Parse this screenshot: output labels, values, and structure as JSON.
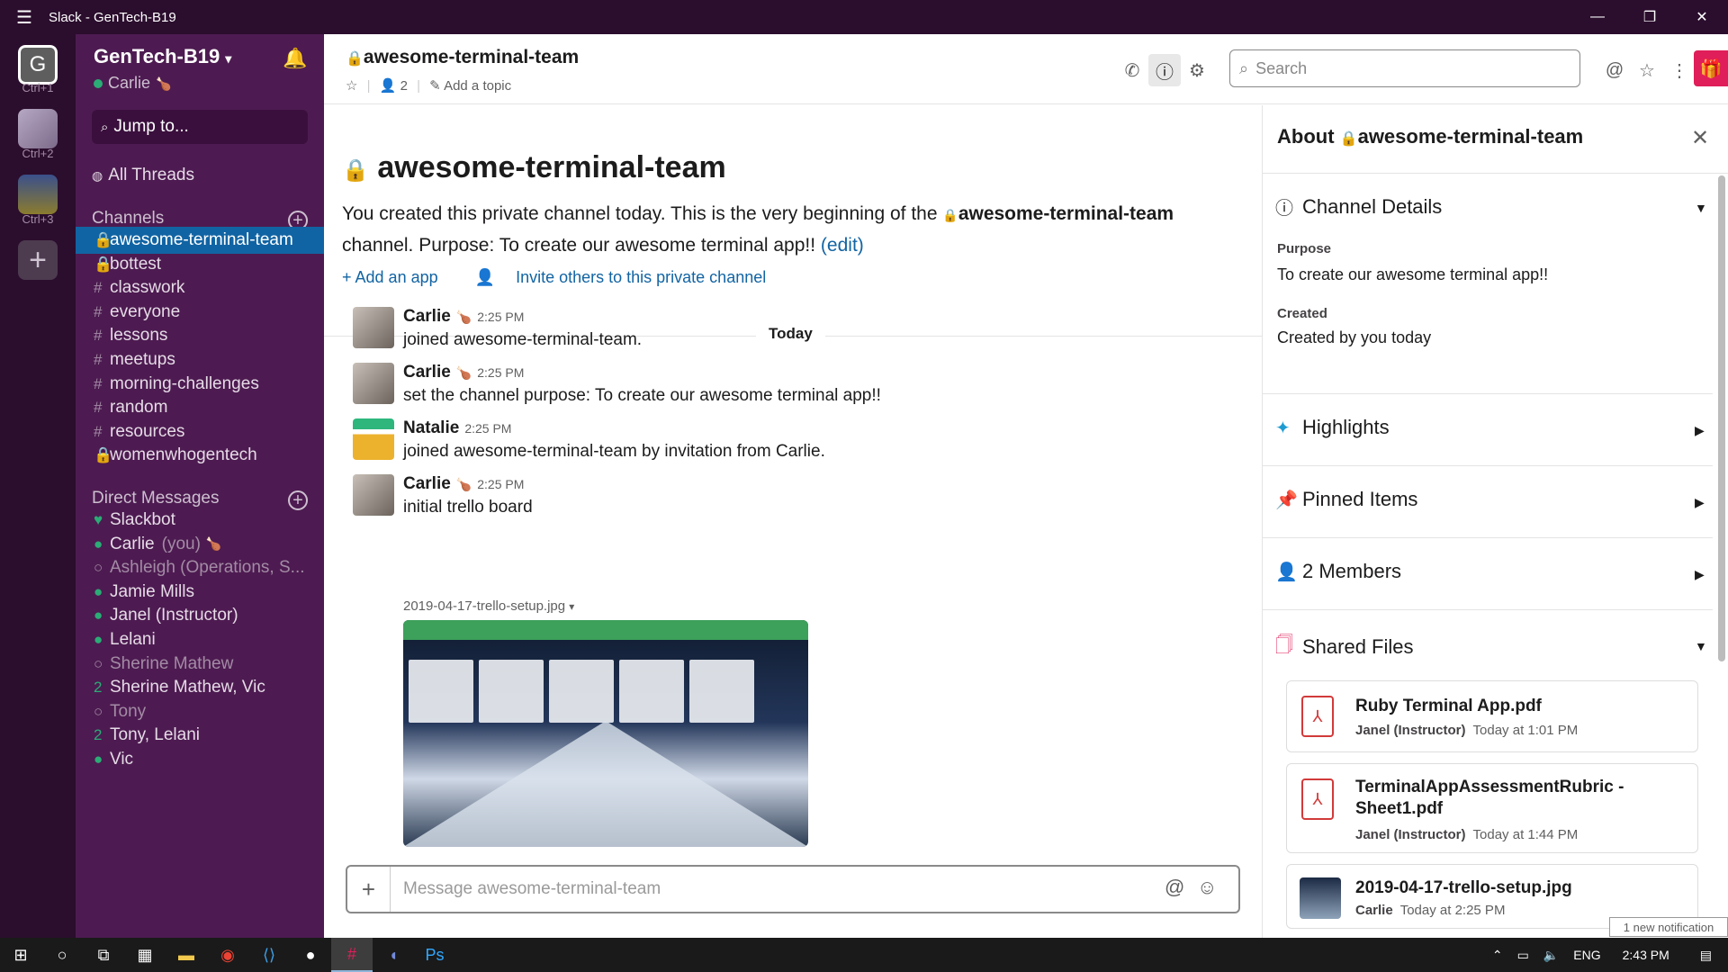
{
  "window": {
    "title": "Slack - GenTech-B19",
    "menu_icon": "hamburger-icon",
    "controls": [
      "—",
      "❐",
      "✕"
    ]
  },
  "workspaces": [
    {
      "initial": "G",
      "shortcut": "Ctrl+1"
    },
    {
      "initial": "",
      "shortcut": "Ctrl+2"
    },
    {
      "initial": "",
      "shortcut": "Ctrl+3"
    }
  ],
  "sidebar": {
    "team_name": "GenTech-B19",
    "user_name": "Carlie",
    "jump_to": "Jump to...",
    "all_threads": "All Threads",
    "channels_heading": "Channels",
    "channels": [
      {
        "prefix": "🔒",
        "name": "awesome-terminal-team",
        "active": true
      },
      {
        "prefix": "🔒",
        "name": "bottest"
      },
      {
        "prefix": "#",
        "name": "classwork"
      },
      {
        "prefix": "#",
        "name": "everyone"
      },
      {
        "prefix": "#",
        "name": "lessons"
      },
      {
        "prefix": "#",
        "name": "meetups"
      },
      {
        "prefix": "#",
        "name": "morning-challenges"
      },
      {
        "prefix": "#",
        "name": "random"
      },
      {
        "prefix": "#",
        "name": "resources"
      },
      {
        "prefix": "🔒",
        "name": "womenwhogentech"
      }
    ],
    "dm_heading": "Direct Messages",
    "dms": [
      {
        "prefix": "♥",
        "name": "Slackbot",
        "online": true
      },
      {
        "prefix": "●",
        "name": "Carlie",
        "suffix": "(you)",
        "online": true
      },
      {
        "prefix": "○",
        "name": "Ashleigh (Operations, S...",
        "online": false
      },
      {
        "prefix": "●",
        "name": "Jamie Mills",
        "online": true
      },
      {
        "prefix": "●",
        "name": "Janel (Instructor)",
        "online": true
      },
      {
        "prefix": "●",
        "name": "Lelani",
        "online": true
      },
      {
        "prefix": "○",
        "name": "Sherine Mathew",
        "online": false
      },
      {
        "prefix": "2",
        "name": "Sherine Mathew, Vic",
        "online": true
      },
      {
        "prefix": "○",
        "name": "Tony",
        "online": false
      },
      {
        "prefix": "2",
        "name": "Tony, Lelani",
        "online": true
      },
      {
        "prefix": "●",
        "name": "Vic",
        "online": true
      }
    ]
  },
  "header": {
    "channel": "awesome-terminal-team",
    "members": "2",
    "add_topic": "Add a topic",
    "search_placeholder": "Search"
  },
  "intro": {
    "title": "awesome-terminal-team",
    "text_before": "You created this private channel today. This is the very beginning of the ",
    "text_channel": "awesome-terminal-team",
    "text_after": " channel. Purpose: To create our awesome terminal app!! ",
    "edit": "(edit)",
    "add_app": "Add an app",
    "invite": "Invite others to this private channel"
  },
  "divider_label": "Today",
  "messages": [
    {
      "author": "Carlie",
      "time": "2:25 PM",
      "body": "joined awesome-terminal-team."
    },
    {
      "author": "Carlie",
      "time": "2:25 PM",
      "body": "set the channel purpose: To create our awesome terminal app!!"
    },
    {
      "author": "Natalie",
      "time": "2:25 PM",
      "body": "joined awesome-terminal-team by invitation from Carlie."
    },
    {
      "author": "Carlie",
      "time": "2:25 PM",
      "body": "initial trello board"
    }
  ],
  "attachment": {
    "filename": "2019-04-17-trello-setup.jpg"
  },
  "composer": {
    "placeholder": "Message awesome-terminal-team"
  },
  "panel": {
    "title_prefix": "About ",
    "title_channel": "awesome-terminal-team",
    "details_heading": "Channel Details",
    "purpose_label": "Purpose",
    "purpose_value": "To create our awesome terminal app!!",
    "created_label": "Created",
    "created_value": "Created by you today",
    "highlights": "Highlights",
    "pinned": "Pinned Items",
    "members": "2 Members",
    "shared_files": "Shared Files",
    "files": [
      {
        "name": "Ruby Terminal App.pdf",
        "author": "Janel (Instructor)",
        "when": "Today at 1:01 PM"
      },
      {
        "name": "TerminalAppAssessmentRubric - Sheet1.pdf",
        "author": "Janel (Instructor)",
        "when": "Today at 1:44 PM"
      },
      {
        "name": "2019-04-17-trello-setup.jpg",
        "author": "Carlie",
        "when": "Today at 2:25 PM"
      }
    ]
  },
  "notification": "1 new notification",
  "taskbar": {
    "tray_lang": "ENG",
    "clock": "2:43 PM"
  },
  "colors": {
    "sidebar": "#4d1b51",
    "active": "#1164a3",
    "titlebar": "#2b0d2d",
    "link": "#1264a3"
  }
}
